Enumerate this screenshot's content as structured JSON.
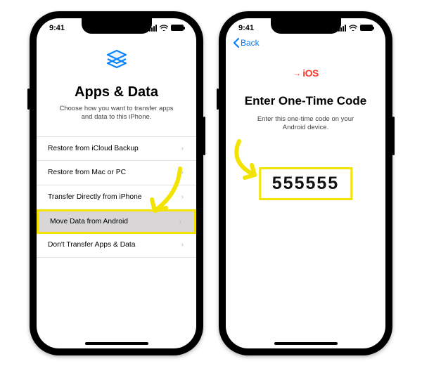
{
  "status": {
    "time": "9:41"
  },
  "screen1": {
    "title": "Apps & Data",
    "subtitle": "Choose how you want to transfer apps and data to this iPhone.",
    "options": [
      "Restore from iCloud Backup",
      "Restore from Mac or PC",
      "Transfer Directly from iPhone",
      "Move Data from Android",
      "Don't Transfer Apps & Data"
    ],
    "highlighted_index": 3
  },
  "screen2": {
    "back_label": "Back",
    "logo_text": "iOS",
    "title": "Enter One-Time Code",
    "subtitle": "Enter this one-time code on your Android device.",
    "code": "555555"
  }
}
